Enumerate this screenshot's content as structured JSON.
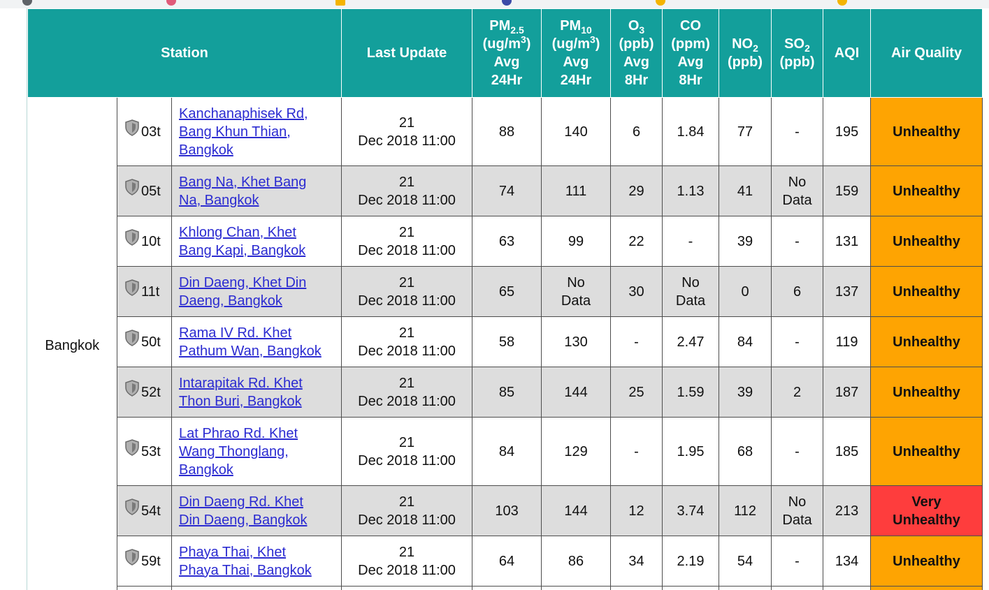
{
  "table": {
    "headers": {
      "station": "Station",
      "last_update": "Last Update",
      "pm25": {
        "name": "PM",
        "sub": "2.5",
        "unit_pre": "(ug/m",
        "unit_sup": "3",
        "unit_post": ")",
        "avg": "Avg",
        "period": "24Hr"
      },
      "pm10": {
        "name": "PM",
        "sub": "10",
        "unit_pre": "(ug/m",
        "unit_sup": "3",
        "unit_post": ")",
        "avg": "Avg",
        "period": "24Hr"
      },
      "o3": {
        "name": "O",
        "sub": "3",
        "unit": "(ppb)",
        "avg": "Avg",
        "period": "8Hr"
      },
      "co": {
        "name": "CO",
        "unit": "(ppm)",
        "avg": "Avg",
        "period": "8Hr"
      },
      "no2": {
        "name": "NO",
        "sub": "2",
        "unit": "(ppb)"
      },
      "so2": {
        "name": "SO",
        "sub": "2",
        "unit": "(ppb)"
      },
      "aqi": "AQI",
      "air_quality": "Air Quality"
    },
    "city": "Bangkok",
    "rows": [
      {
        "code": "03t",
        "location": [
          "Kanchanaphisek Rd,",
          "Bang Khun Thian,",
          "Bangkok"
        ],
        "date_line1": "21",
        "date_line2": "Dec 2018 11:00",
        "pm25": "88",
        "pm10": "140",
        "o3": "6",
        "co": "1.84",
        "no2": "77",
        "so2": "-",
        "aqi": "195",
        "quality": "Unhealthy",
        "level": "unhealthy"
      },
      {
        "code": "05t",
        "location": [
          "Bang Na, Khet Bang",
          "Na, Bangkok"
        ],
        "date_line1": "21",
        "date_line2": "Dec 2018 11:00",
        "pm25": "74",
        "pm10": "111",
        "o3": "29",
        "co": "1.13",
        "no2": "41",
        "so2": "No Data",
        "aqi": "159",
        "quality": "Unhealthy",
        "level": "unhealthy"
      },
      {
        "code": "10t",
        "location": [
          "Khlong Chan, Khet",
          "Bang Kapi, Bangkok"
        ],
        "date_line1": "21",
        "date_line2": "Dec 2018 11:00",
        "pm25": "63",
        "pm10": "99",
        "o3": "22",
        "co": "-",
        "no2": "39",
        "so2": "-",
        "aqi": "131",
        "quality": "Unhealthy",
        "level": "unhealthy"
      },
      {
        "code": "11t",
        "location": [
          "Din Daeng, Khet Din",
          "Daeng, Bangkok"
        ],
        "date_line1": "21",
        "date_line2": "Dec 2018 11:00",
        "pm25": "65",
        "pm10": "No Data",
        "o3": "30",
        "co": "No Data",
        "no2": "0",
        "so2": "6",
        "aqi": "137",
        "quality": "Unhealthy",
        "level": "unhealthy"
      },
      {
        "code": "50t",
        "location": [
          "Rama IV Rd. Khet",
          "Pathum Wan, Bangkok"
        ],
        "date_line1": "21",
        "date_line2": "Dec 2018 11:00",
        "pm25": "58",
        "pm10": "130",
        "o3": "-",
        "co": "2.47",
        "no2": "84",
        "so2": "-",
        "aqi": "119",
        "quality": "Unhealthy",
        "level": "unhealthy"
      },
      {
        "code": "52t",
        "location": [
          "Intarapitak Rd. Khet",
          "Thon Buri, Bangkok"
        ],
        "date_line1": "21",
        "date_line2": "Dec 2018 11:00",
        "pm25": "85",
        "pm10": "144",
        "o3": "25",
        "co": "1.59",
        "no2": "39",
        "so2": "2",
        "aqi": "187",
        "quality": "Unhealthy",
        "level": "unhealthy"
      },
      {
        "code": "53t",
        "location": [
          "Lat Phrao Rd. Khet",
          "Wang Thonglang,",
          "Bangkok"
        ],
        "date_line1": "21",
        "date_line2": "Dec 2018 11:00",
        "pm25": "84",
        "pm10": "129",
        "o3": "-",
        "co": "1.95",
        "no2": "68",
        "so2": "-",
        "aqi": "185",
        "quality": "Unhealthy",
        "level": "unhealthy"
      },
      {
        "code": "54t",
        "location": [
          "Din Daeng Rd. Khet",
          "Din Daeng, Bangkok"
        ],
        "date_line1": "21",
        "date_line2": "Dec 2018 11:00",
        "pm25": "103",
        "pm10": "144",
        "o3": "12",
        "co": "3.74",
        "no2": "112",
        "so2": "No Data",
        "aqi": "213",
        "quality": "Very Unhealthy",
        "level": "very"
      },
      {
        "code": "59t",
        "location": [
          "Phaya Thai, Khet",
          "Phaya Thai, Bangkok"
        ],
        "date_line1": "21",
        "date_line2": "Dec 2018 11:00",
        "pm25": "64",
        "pm10": "86",
        "o3": "34",
        "co": "2.19",
        "no2": "54",
        "so2": "-",
        "aqi": "134",
        "quality": "Unhealthy",
        "level": "unhealthy"
      }
    ]
  },
  "colors": {
    "header_bg": "#139f9b",
    "unhealthy": "#fea402",
    "very_unhealthy": "#fe3d3d",
    "row_alt": "#dddddd",
    "link": "#2b2bd1"
  },
  "icons": {
    "station_marker": "shield-icon"
  }
}
